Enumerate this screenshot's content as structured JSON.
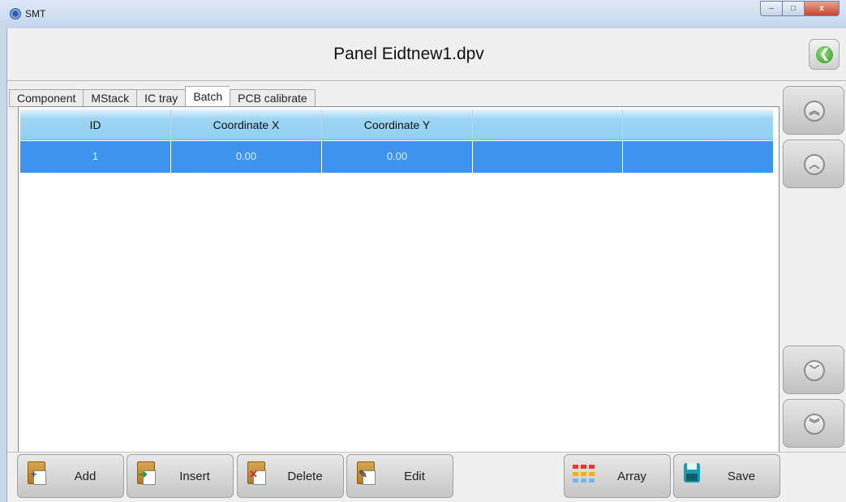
{
  "window": {
    "title": "SMT",
    "buttons": {
      "minimize": "–",
      "maximize": "□",
      "close": "x"
    }
  },
  "header": {
    "title": "Panel Eidtnew1.dpv",
    "back_icon": "back-arrow-icon"
  },
  "tabs": [
    {
      "label": "Component",
      "active": false
    },
    {
      "label": "MStack",
      "active": false
    },
    {
      "label": "IC tray",
      "active": false
    },
    {
      "label": "Batch",
      "active": true
    },
    {
      "label": "PCB calibrate",
      "active": false
    }
  ],
  "table": {
    "columns": [
      "ID",
      "Coordinate X",
      "Coordinate Y",
      "",
      ""
    ],
    "rows": [
      {
        "id": "1",
        "x": "0.00",
        "y": "0.00",
        "c4": "",
        "c5": "",
        "selected": true
      }
    ]
  },
  "side_nav": {
    "first": {
      "icon": "double-chevron-up-icon",
      "glyph": "︽"
    },
    "prev": {
      "icon": "chevron-up-icon",
      "glyph": "︿"
    },
    "next": {
      "icon": "chevron-down-icon",
      "glyph": "﹀"
    },
    "last": {
      "icon": "double-chevron-down-icon",
      "glyph": "︾"
    }
  },
  "toolbar": {
    "add_label": "Add",
    "insert_label": "Insert",
    "delete_label": "Delete",
    "edit_label": "Edit",
    "array_label": "Array",
    "save_label": "Save"
  },
  "colors": {
    "selected_row": "#3d94ee",
    "header_gradient_top": "#e3f3ff",
    "header_gradient_bottom": "#8fcff3",
    "back_button_green": "#2e9a20"
  }
}
